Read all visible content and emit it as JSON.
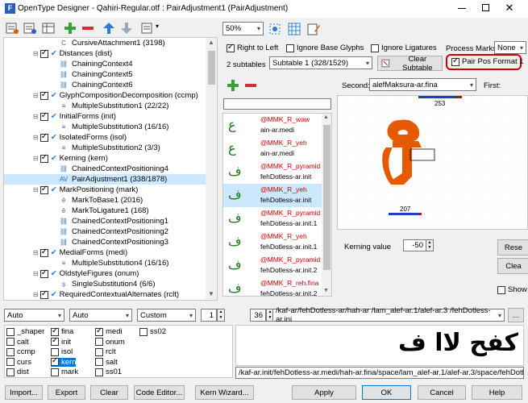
{
  "window": {
    "title": "OpenType Designer - Qahiri-Regular.otf : PairAdjustment1 (PairAdjustment)"
  },
  "tree": [
    {
      "indent": 72,
      "icon": "C",
      "label": "CursiveAttachment1 (3198)",
      "kind": "sub"
    },
    {
      "indent": 50,
      "icon": "check",
      "label": "Distances (dist)",
      "kind": "feature"
    },
    {
      "indent": 72,
      "icon": "chain",
      "label": "ChainingContext4",
      "kind": "sub"
    },
    {
      "indent": 72,
      "icon": "chain",
      "label": "ChainingContext5",
      "kind": "sub"
    },
    {
      "indent": 72,
      "icon": "chain",
      "label": "ChainingContext6",
      "kind": "sub"
    },
    {
      "indent": 50,
      "icon": "check",
      "label": "GlyphCompositionDecomposition (ccmp)",
      "kind": "feature"
    },
    {
      "indent": 72,
      "icon": "multi",
      "label": "MultipleSubstitution1 (22/22)",
      "kind": "sub"
    },
    {
      "indent": 50,
      "icon": "check",
      "label": "InitialForms (init)",
      "kind": "feature"
    },
    {
      "indent": 72,
      "icon": "multi",
      "label": "MultipleSubstitution3 (16/16)",
      "kind": "sub"
    },
    {
      "indent": 50,
      "icon": "check",
      "label": "IsolatedForms (isol)",
      "kind": "feature"
    },
    {
      "indent": 72,
      "icon": "multi",
      "label": "MultipleSubstitution2 (3/3)",
      "kind": "sub"
    },
    {
      "indent": 50,
      "icon": "check",
      "label": "Kerning (kern)",
      "kind": "feature"
    },
    {
      "indent": 72,
      "icon": "chain",
      "label": "ChainedContextPositioning4",
      "kind": "sub"
    },
    {
      "indent": 72,
      "icon": "AV",
      "label": "PairAdjustment1 (338/1878)",
      "kind": "sub",
      "selected": true
    },
    {
      "indent": 50,
      "icon": "check",
      "label": "MarkPositioning (mark)",
      "kind": "feature"
    },
    {
      "indent": 72,
      "icon": "mark",
      "label": "MarkToBase1 (2016)",
      "kind": "sub"
    },
    {
      "indent": 72,
      "icon": "mark",
      "label": "MarkToLigature1 (168)",
      "kind": "sub"
    },
    {
      "indent": 72,
      "icon": "chain",
      "label": "ChainedContextPositioning1",
      "kind": "sub"
    },
    {
      "indent": 72,
      "icon": "chain",
      "label": "ChainedContextPositioning2",
      "kind": "sub"
    },
    {
      "indent": 72,
      "icon": "chain",
      "label": "ChainedContextPositioning3",
      "kind": "sub"
    },
    {
      "indent": 50,
      "icon": "check",
      "label": "MedialForms (medi)",
      "kind": "feature"
    },
    {
      "indent": 72,
      "icon": "multi",
      "label": "MultipleSubstitution4 (16/16)",
      "kind": "sub"
    },
    {
      "indent": 50,
      "icon": "check",
      "label": "OldstyleFigures (onum)",
      "kind": "feature"
    },
    {
      "indent": 72,
      "icon": "single",
      "label": "SingleSubstitution4 (6/6)",
      "kind": "sub"
    },
    {
      "indent": 50,
      "icon": "check",
      "label": "RequiredContextualAlternates (rclt)",
      "kind": "feature"
    }
  ],
  "zoom": "50%",
  "options": {
    "rtl": "Right to Left",
    "ignore_base": "Ignore Base Glyphs",
    "ignore_lig": "Ignore Ligatures",
    "process_marks": "Process Marks:",
    "process_marks_value": "None",
    "subtables": "2 subtables",
    "subtable_value": "Subtable 1 (328/1529)",
    "clear_subtable": "Clear Subtable",
    "pair_pos_format": "Pair Pos Format 1"
  },
  "second": {
    "label": "Second:",
    "value": "alefMaksura-ar.fina",
    "first_label": "First:"
  },
  "glyph_list": [
    {
      "class": "@MMK_R_waw",
      "glyph": "ain-ar.medi",
      "shape": "ع"
    },
    {
      "class": "@MMK_R_yeh",
      "glyph": "ain-ar.medi",
      "shape": "ع"
    },
    {
      "class": "@MMK_R_pyramid",
      "glyph": "fehDotless-ar.init",
      "shape": "ف"
    },
    {
      "class": "@MMK_R_yeh",
      "glyph": "fehDotless-ar.init",
      "shape": "ف",
      "selected": true
    },
    {
      "class": "@MMK_R_pyramid",
      "glyph": "fehDotless-ar.init.1",
      "shape": "ف"
    },
    {
      "class": "@MMK_R_yeh",
      "glyph": "fehDotless-ar.init.1",
      "shape": "ف"
    },
    {
      "class": "@MMK_R_pyramid",
      "glyph": "fehDotless-ar.init.2",
      "shape": "ف"
    },
    {
      "class": "@MMK_R_reh.fina",
      "glyph": "fehDotless-ar.init.2",
      "shape": "ف"
    }
  ],
  "preview": {
    "top_value": "253",
    "bottom_value": "207"
  },
  "kerning": {
    "label": "Kerning value",
    "value": "-50",
    "reset": "Rese",
    "clear": "Clea",
    "show": "Show"
  },
  "bottom_controls": {
    "script": "Auto",
    "language": "Auto",
    "mode": "Custom",
    "num1": "1",
    "num2": "36",
    "text_input": "/kaf-ar/fehDotless-ar/hah-ar /lam_alef-ar.1/alef-ar.3 /fehDotless-ar.ini",
    "glyph_output": "/kaf-ar.init/fehDotless-ar.medi/hah-ar.fina/space/lam_alef-ar.1/alef-ar.3/space/fehDotless-ar.i",
    "rendered_text": "كفح لاا ف"
  },
  "features": [
    {
      "label": "_shaper",
      "on": false
    },
    {
      "label": "fina",
      "on": true
    },
    {
      "label": "medi",
      "on": true
    },
    {
      "label": "ss02",
      "on": false
    },
    {
      "label": "calt",
      "on": false
    },
    {
      "label": "init",
      "on": true
    },
    {
      "label": "onum",
      "on": false
    },
    {
      "label": "ccmp",
      "on": false
    },
    {
      "label": "isol",
      "on": false
    },
    {
      "label": "rclt",
      "on": false
    },
    {
      "label": "curs",
      "on": false
    },
    {
      "label": "kern",
      "on": true
    },
    {
      "label": "salt",
      "on": false
    },
    {
      "label": "dist",
      "on": false
    },
    {
      "label": "mark",
      "on": false
    },
    {
      "label": "ss01",
      "on": false
    }
  ],
  "footer": {
    "import": "Import...",
    "export": "Export",
    "clear": "Clear",
    "code_editor": "Code Editor...",
    "kern_wizard": "Kern Wizard...",
    "apply": "Apply",
    "ok": "OK",
    "cancel": "Cancel",
    "help": "Help"
  },
  "colors": {
    "accent": "#e55a00",
    "selection": "#cce8ff",
    "highlight_red": "#d00000",
    "kern_blue": "#2040c0"
  }
}
